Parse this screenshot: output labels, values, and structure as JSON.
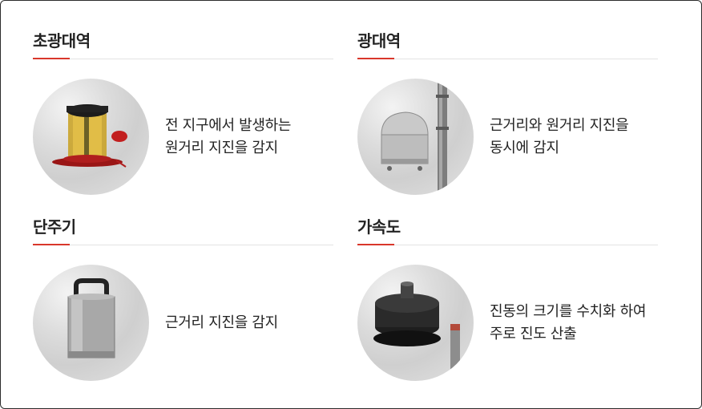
{
  "sections": [
    {
      "title": "초광대역",
      "desc_lines": [
        "전 지구에서 발생하는",
        "원거리 지진을 감지"
      ],
      "image": "broadband-seismometer-photo"
    },
    {
      "title": "광대역",
      "desc_lines": [
        "근거리와 원거리 지진을",
        "동시에 감지"
      ],
      "image": "wideband-seismometer-photo"
    },
    {
      "title": "단주기",
      "desc_lines": [
        "근거리 지진을 감지"
      ],
      "image": "short-period-seismometer-photo"
    },
    {
      "title": "가속도",
      "desc_lines": [
        "진동의 크기를 수치화 하여",
        "주로 진도 산출"
      ],
      "image": "accelerometer-photo"
    }
  ],
  "colors": {
    "accent": "#d9372b",
    "text": "#222222",
    "rule": "#e3e3e3",
    "border": "#2b2b2b"
  }
}
